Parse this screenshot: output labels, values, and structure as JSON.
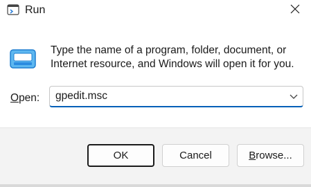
{
  "window": {
    "title": "Run",
    "close_icon": "close-icon"
  },
  "main": {
    "description": "Type the name of a program, folder, document, or Internet resource, and Windows will open it for you.",
    "open_label_accel": "O",
    "open_label_rest": "pen:",
    "input_value": "gpedit.msc"
  },
  "buttons": {
    "ok_label": "OK",
    "cancel_label": "Cancel",
    "browse_accel": "B",
    "browse_rest": "rowse..."
  },
  "colors": {
    "accent": "#005fb8",
    "footer_bg": "#f3f3f3",
    "icon_blue": "#3aa0e8"
  }
}
